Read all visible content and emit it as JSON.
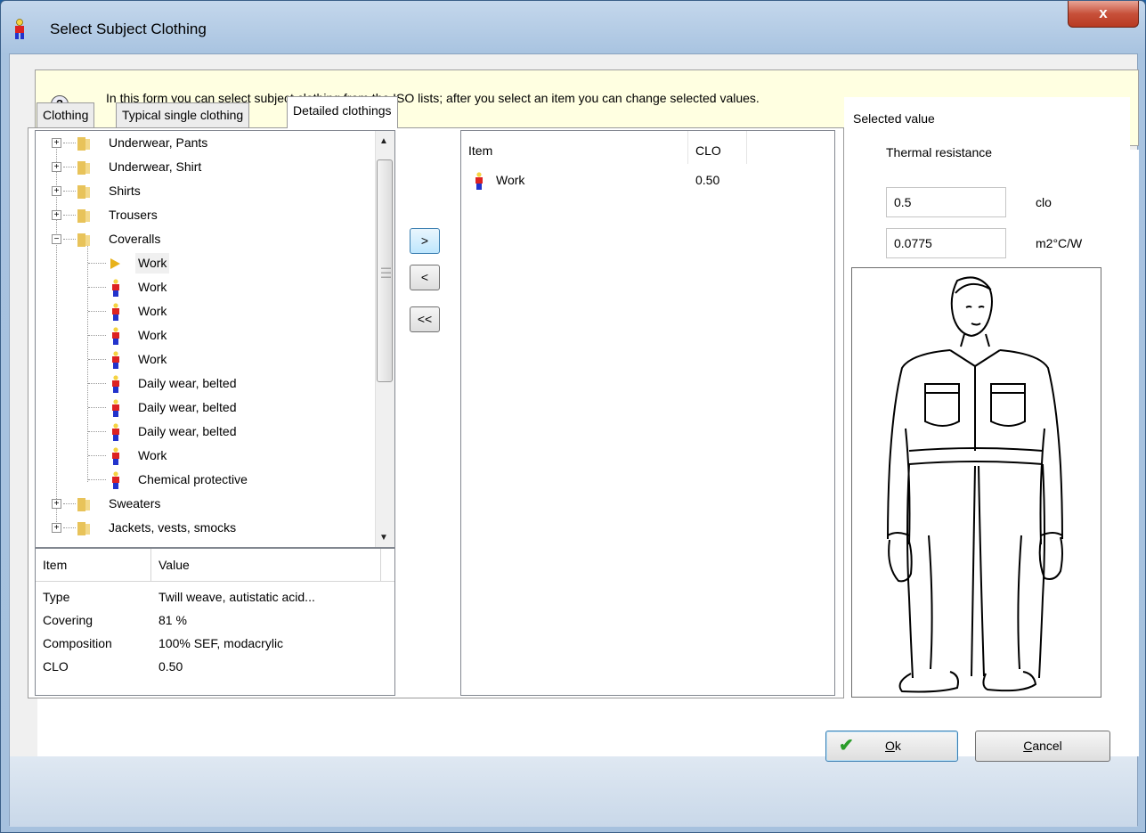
{
  "window": {
    "title": "Select Subject Clothing",
    "close_glyph": "x"
  },
  "info": {
    "icon": "question-icon",
    "text": "In this form you can select subject clothing from the ISO lists; after you select an item you can change selected values."
  },
  "tabs": [
    {
      "label": "Clothing"
    },
    {
      "label": "Typical single clothing"
    },
    {
      "label": "Detailed clothings"
    }
  ],
  "tree": {
    "items": [
      {
        "label": "Underwear, Pants",
        "kind": "folder"
      },
      {
        "label": "Underwear, Shirt",
        "kind": "folder"
      },
      {
        "label": "Shirts",
        "kind": "folder"
      },
      {
        "label": "Trousers",
        "kind": "folder"
      },
      {
        "label": "Coveralls",
        "kind": "folder-open"
      },
      {
        "label": "Work",
        "kind": "selected-child"
      },
      {
        "label": "Work",
        "kind": "child"
      },
      {
        "label": "Work",
        "kind": "child"
      },
      {
        "label": "Work",
        "kind": "child"
      },
      {
        "label": "Work",
        "kind": "child"
      },
      {
        "label": "Daily wear, belted",
        "kind": "child"
      },
      {
        "label": "Daily wear, belted",
        "kind": "child"
      },
      {
        "label": "Daily wear, belted",
        "kind": "child"
      },
      {
        "label": "Work",
        "kind": "child"
      },
      {
        "label": "Chemical protective",
        "kind": "child"
      },
      {
        "label": "Sweaters",
        "kind": "folder"
      },
      {
        "label": "Jackets, vests, smocks",
        "kind": "folder"
      }
    ]
  },
  "details": {
    "headers": [
      "Item",
      "Value"
    ],
    "rows": [
      [
        "Type",
        "Twill weave, autistatic acid..."
      ],
      [
        "Covering",
        "81 %"
      ],
      [
        "Composition",
        "100% SEF, modacrylic"
      ],
      [
        "CLO",
        "0.50"
      ]
    ]
  },
  "move_buttons": {
    "add": ">",
    "remove": "<",
    "remove_all": "<<"
  },
  "selected_list": {
    "headers": [
      "Item",
      "CLO"
    ],
    "rows": [
      [
        "Work",
        "0.50"
      ]
    ]
  },
  "selected_value": {
    "title": "Selected value",
    "subtitle": "Thermal resistance",
    "clo_value": "0.5",
    "clo_unit": "clo",
    "si_value": "0.0775",
    "si_unit": "m2°C/W"
  },
  "footer": {
    "ok_label": "k",
    "ok_mnemonic": "O",
    "cancel_label": "ancel",
    "cancel_mnemonic": "C"
  },
  "colors": {
    "info_bg": "#ffffe1",
    "accent": "#3c7fb1",
    "close": "#c7503a"
  }
}
